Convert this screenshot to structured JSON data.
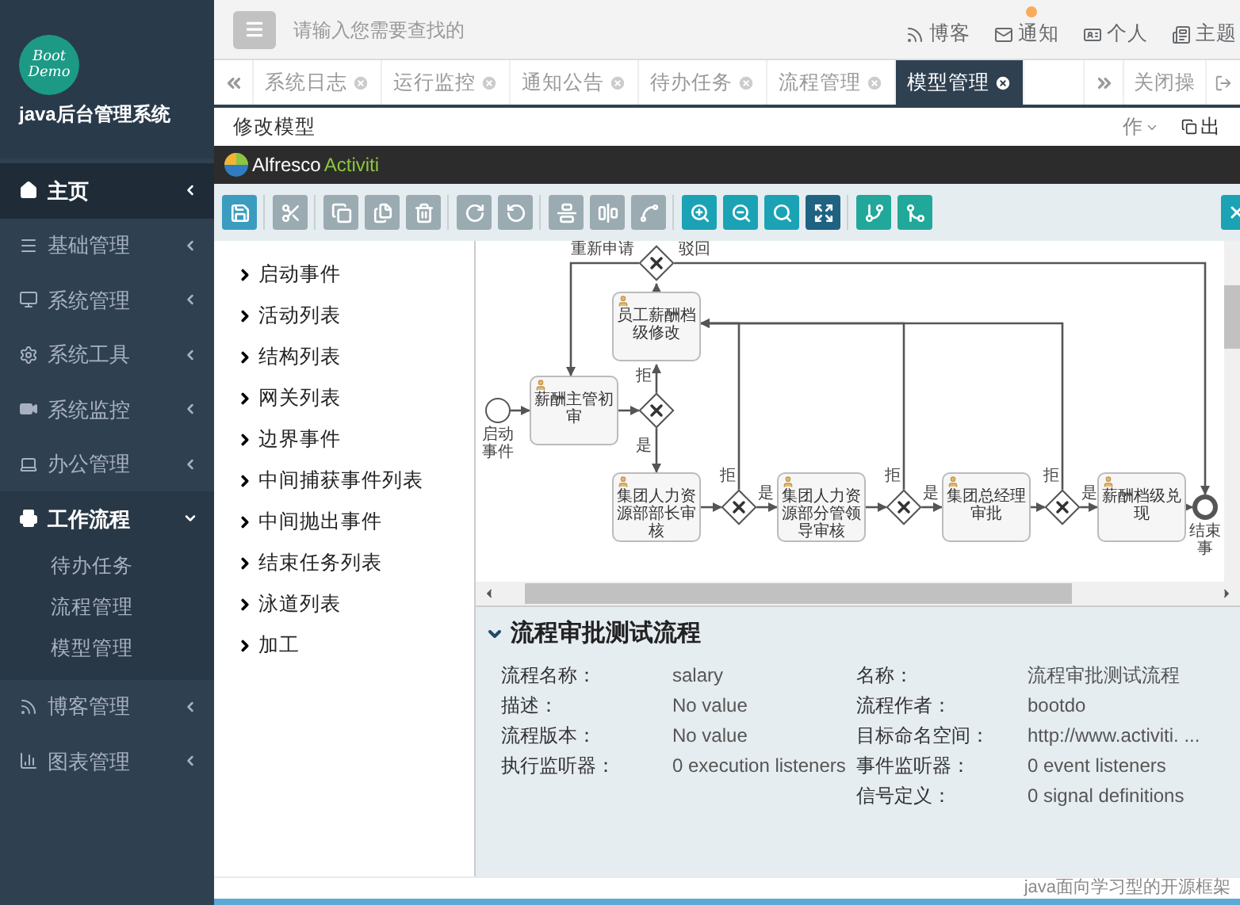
{
  "sidebar": {
    "logo": {
      "line1": "Boot",
      "line2": "Demo"
    },
    "title": "java后台管理系统",
    "items": [
      {
        "label": "主页",
        "selected": true,
        "expanded": false
      },
      {
        "label": "基础管理",
        "selected": false,
        "expanded": false
      },
      {
        "label": "系统管理",
        "selected": false,
        "expanded": false
      },
      {
        "label": "系统工具",
        "selected": false,
        "expanded": false
      },
      {
        "label": "系统监控",
        "selected": false,
        "expanded": false
      },
      {
        "label": "办公管理",
        "selected": false,
        "expanded": false
      },
      {
        "label": "工作流程",
        "selected": false,
        "expanded": true,
        "children": [
          {
            "label": "待办任务",
            "selected": false
          },
          {
            "label": "流程管理",
            "selected": false
          },
          {
            "label": "模型管理",
            "selected": false
          }
        ]
      },
      {
        "label": "博客管理",
        "selected": false,
        "expanded": false
      },
      {
        "label": "图表管理",
        "selected": false,
        "expanded": false
      }
    ]
  },
  "header": {
    "search": {
      "placeholder": "请输入您需要查找的"
    },
    "links": [
      {
        "label": "博客",
        "badge": false
      },
      {
        "label": "通知",
        "badge": true
      },
      {
        "label": "个人",
        "badge": false
      },
      {
        "label": "主题",
        "badge": false
      }
    ]
  },
  "tabs": [
    {
      "label": "系统日志",
      "selected": false
    },
    {
      "label": "运行监控",
      "selected": false
    },
    {
      "label": "通知公告",
      "selected": false
    },
    {
      "label": "待办任务",
      "selected": false
    },
    {
      "label": "流程管理",
      "selected": false
    },
    {
      "label": "模型管理",
      "selected": true
    }
  ],
  "tab_tools": {
    "close_ops": "关闭操"
  },
  "page": {
    "title": "修改模型",
    "actions": [
      "作",
      "出"
    ]
  },
  "editor": {
    "brand": {
      "name": "Alfresco",
      "product": "Activiti"
    },
    "palette": [
      "启动事件",
      "活动列表",
      "结构列表",
      "网关列表",
      "边界事件",
      "中间捕获事件列表",
      "中间抛出事件",
      "结束任务列表",
      "泳道列表",
      "加工"
    ],
    "diagram": {
      "nodes": [
        {
          "kind": "start",
          "label": "启动事件"
        },
        {
          "kind": "task",
          "label": "薪酬主管初审"
        },
        {
          "kind": "gateway"
        },
        {
          "kind": "task",
          "label": "员工薪酬档级修改"
        },
        {
          "kind": "gateway"
        },
        {
          "kind": "task",
          "label": "集团人力资源部部长审核"
        },
        {
          "kind": "gateway"
        },
        {
          "kind": "task",
          "label": "集团人力资源部分管领导审核"
        },
        {
          "kind": "gateway"
        },
        {
          "kind": "task",
          "label": "集团总经理审批"
        },
        {
          "kind": "gateway"
        },
        {
          "kind": "task",
          "label": "薪酬档级兑现"
        },
        {
          "kind": "end",
          "label": "结束事"
        }
      ],
      "edge_labels": [
        "重新申请",
        "驳回",
        "拒",
        "是",
        "拒",
        "是",
        "拒",
        "是",
        "拒",
        "是"
      ]
    },
    "properties": {
      "title": "流程审批测试流程",
      "rows": [
        {
          "left": {
            "label": "流程名称：",
            "value": "salary"
          },
          "right": {
            "label": "名称：",
            "value": "流程审批测试流程"
          }
        },
        {
          "left": {
            "label": "描述：",
            "value": "No value"
          },
          "right": {
            "label": "流程作者：",
            "value": "bootdo"
          }
        },
        {
          "left": {
            "label": "流程版本：",
            "value": "No value"
          },
          "right": {
            "label": "目标命名空间：",
            "value": "http://www.activiti. ..."
          }
        },
        {
          "left": {
            "label": "执行监听器：",
            "value": "0 execution listeners"
          },
          "right": {
            "label": "事件监听器：",
            "value": "0 event listeners"
          }
        },
        {
          "right": {
            "label": "信号定义：",
            "value": "0 signal definitions"
          }
        }
      ]
    }
  },
  "footer": "java面向学习型的开源框架"
}
